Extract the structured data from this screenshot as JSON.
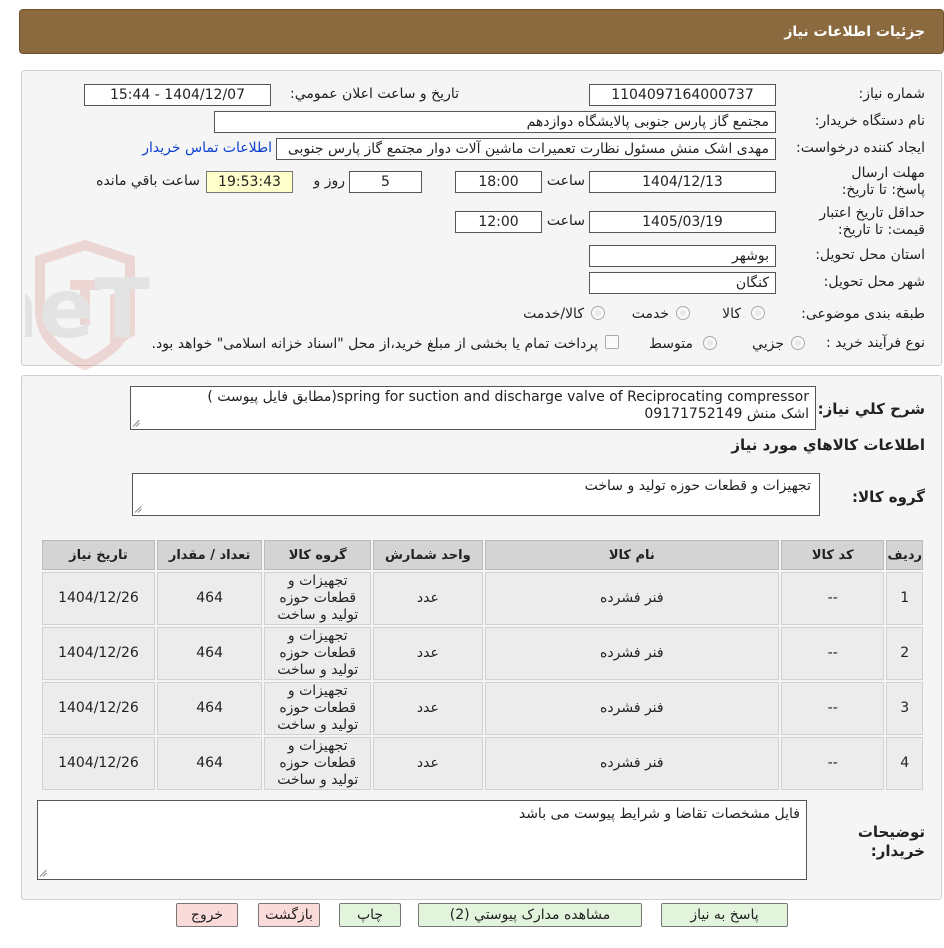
{
  "header": {
    "title": "جزئيات اطلاعات نياز"
  },
  "form": {
    "need_number_label": "شماره نياز:",
    "need_number": "1104097164000737",
    "announce_label": "تاريخ و ساعت اعلان عمومي:",
    "announce_value": "1404/12/07 - 15:44",
    "buyer_org_label": "نام دستگاه خريدار:",
    "buyer_org": "مجتمع گاز پارس جنوبی  پالایشگاه دوازدهم",
    "requester_label": "ايجاد کننده درخواست:",
    "requester": "مهدی اشک منش مسئول نظارت تعمیرات ماشین آلات دوار مجتمع گاز پارس جنوبی",
    "contact_link": "اطلاعات تماس خريدار",
    "deadline_label": "مهلت ارسال پاسخ: تا تاريخ:",
    "deadline_date": "1404/12/13",
    "time_label": "ساعت",
    "deadline_time": "18:00",
    "days": "5",
    "days_label": "روز و",
    "remaining_time": "19:53:43",
    "remaining_label": "ساعت باقي مانده",
    "validity_label": "حداقل تاريخ اعتبار قيمت: تا تاريخ:",
    "validity_date": "1405/03/19",
    "validity_time": "12:00",
    "province_label": "استان محل تحويل:",
    "province": "بوشهر",
    "city_label": "شهر محل تحويل:",
    "city": "کنگان",
    "category_label": "طبقه بندی موضوعی:",
    "category_options": [
      "کالا",
      "خدمت",
      "کالا/خدمت"
    ],
    "process_label": "نوع فرآيند خريد :",
    "process_options": [
      "جزيي",
      "متوسط"
    ],
    "process_note": "پرداخت تمام يا بخشی از مبلغ خريد،از محل \"اسناد خزانه اسلامی\" خواهد بود."
  },
  "details": {
    "general_desc_label": "شرح كلي نياز:",
    "general_desc_line1": "spring for suction and discharge valve of Reciprocating compressor(مطابق فایل پیوست )",
    "general_desc_line2": "اشک منش 09171752149",
    "goods_info_title": "اطلاعات كالاهاي مورد نياز",
    "goods_group_label": "گروه کالا:",
    "goods_group": "تجهیزات و قطعات حوزه تولید و ساخت"
  },
  "table": {
    "headers": [
      "رديف",
      "کد کالا",
      "نام کالا",
      "واحد شمارش",
      "گروه کالا",
      "تعداد / مقدار",
      "تاريخ نياز"
    ],
    "rows": [
      {
        "row": "1",
        "code": "--",
        "name": "فنر فشرده",
        "unit": "عدد",
        "group": "تجهیزات و قطعات حوزه تولید و ساخت",
        "qty": "464",
        "date": "1404/12/26"
      },
      {
        "row": "2",
        "code": "--",
        "name": "فنر فشرده",
        "unit": "عدد",
        "group": "تجهیزات و قطعات حوزه تولید و ساخت",
        "qty": "464",
        "date": "1404/12/26"
      },
      {
        "row": "3",
        "code": "--",
        "name": "فنر فشرده",
        "unit": "عدد",
        "group": "تجهیزات و قطعات حوزه تولید و ساخت",
        "qty": "464",
        "date": "1404/12/26"
      },
      {
        "row": "4",
        "code": "--",
        "name": "فنر فشرده",
        "unit": "عدد",
        "group": "تجهیزات و قطعات حوزه تولید و ساخت",
        "qty": "464",
        "date": "1404/12/26"
      }
    ]
  },
  "buyer_notes": {
    "label": "توضيحات خريدار:",
    "text": "فایل مشخصات تقاضا و شرایط پیوست می باشد"
  },
  "buttons": {
    "reply": "پاسخ به نياز",
    "view_docs": "مشاهده مدارک پيوستي (2)",
    "print": "چاپ",
    "back": "بازگشت",
    "exit": "خروج"
  },
  "watermark": {
    "text": "AriaTender.neT"
  },
  "colors": {
    "header_bg": "#8b6a3f",
    "link": "#0b3fcf",
    "green_btn": "#e2f5dc",
    "pink_btn": "#fbdada",
    "remaining_bg": "#ffffcc"
  }
}
